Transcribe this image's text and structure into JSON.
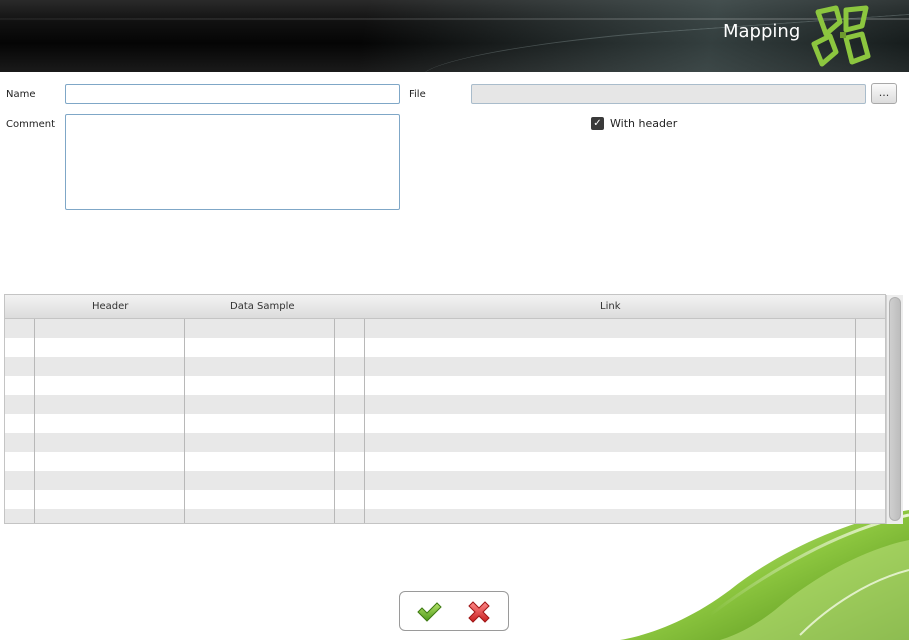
{
  "header": {
    "title": "Mapping",
    "logo_icon": "clover-logo-icon"
  },
  "form": {
    "name_label": "Name",
    "name_value": "",
    "comment_label": "Comment",
    "comment_value": "",
    "file_label": "File",
    "file_value": "",
    "browse_label": "...",
    "with_header_label": "With header",
    "with_header_checked": true
  },
  "grid": {
    "columns": [
      "",
      "Header",
      "Data Sample",
      "",
      "Link",
      ""
    ],
    "row_count": 11
  },
  "footer": {
    "ok_icon": "check-icon",
    "cancel_icon": "cross-icon"
  },
  "colors": {
    "accent_green": "#8cc63f",
    "header_dark": "#111111",
    "input_border": "#7fa7c7"
  }
}
